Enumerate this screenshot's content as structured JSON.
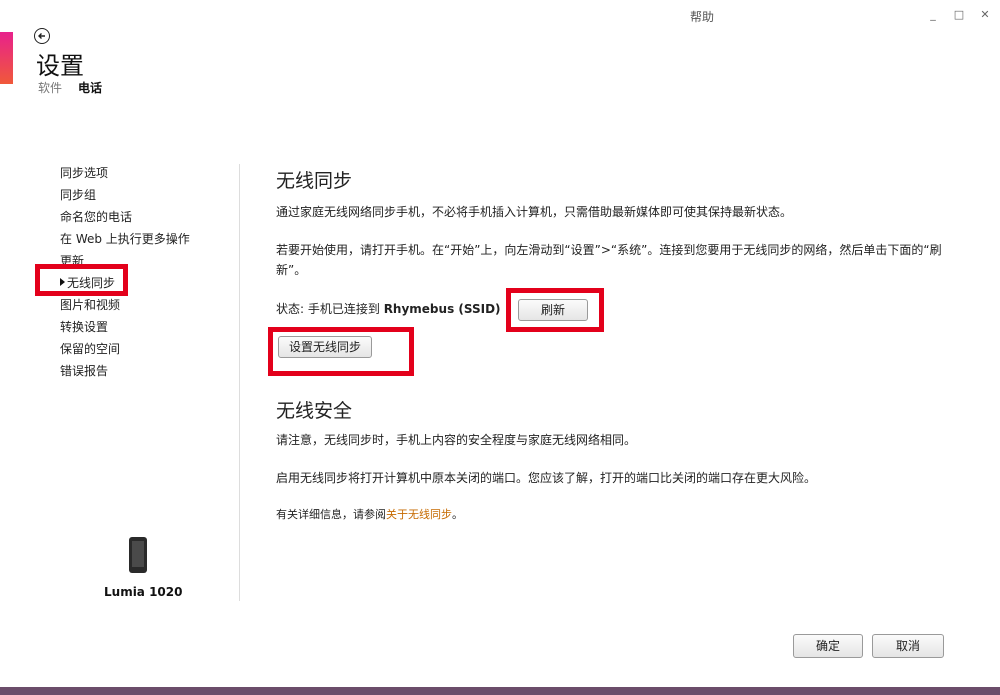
{
  "header": {
    "help": "帮助",
    "window_controls": [
      "minimize",
      "maximize",
      "close"
    ],
    "title": "设置",
    "subnav": [
      {
        "label": "软件",
        "active": false
      },
      {
        "label": "电话",
        "active": true
      }
    ]
  },
  "sidebar": {
    "items": [
      {
        "label": "同步选项"
      },
      {
        "label": "同步组"
      },
      {
        "label": "命名您的电话"
      },
      {
        "label": "在 Web 上执行更多操作"
      },
      {
        "label": "更新"
      },
      {
        "label": "无线同步",
        "selected": true
      },
      {
        "label": "图片和视频"
      },
      {
        "label": "转换设置"
      },
      {
        "label": "保留的空间"
      },
      {
        "label": "错误报告"
      }
    ],
    "device_name": "Lumia 1020"
  },
  "main": {
    "wireless_sync": {
      "title": "无线同步",
      "desc": "通过家庭无线网络同步手机，不必将手机插入计算机，只需借助最新媒体即可使其保持最新状态。",
      "instructions": "若要开始使用，请打开手机。在“开始”上，向左滑动到“设置”>“系统”。连接到您要用于无线同步的网络，然后单击下面的“刷新”。",
      "status_label": "状态: 手机已连接到",
      "status_value": "Rhymebus (SSID)",
      "refresh_button": "刷新",
      "setup_button": "设置无线同步"
    },
    "wireless_security": {
      "title": "无线安全",
      "note": "请注意，无线同步时，手机上内容的安全程度与家庭无线网络相同。",
      "warning": "启用无线同步将打开计算机中原本关闭的端口。您应该了解，打开的端口比关闭的端口存在更大风险。",
      "more_info_prefix": "有关详细信息，请参阅",
      "more_info_link": "关于无线同步",
      "more_info_suffix": "。"
    }
  },
  "footer": {
    "ok_button": "确定",
    "cancel_button": "取消"
  },
  "colors": {
    "highlight": "#e3001b",
    "link": "#c66a00",
    "accent_gradient": [
      "#e8218c",
      "#f0593a"
    ]
  }
}
